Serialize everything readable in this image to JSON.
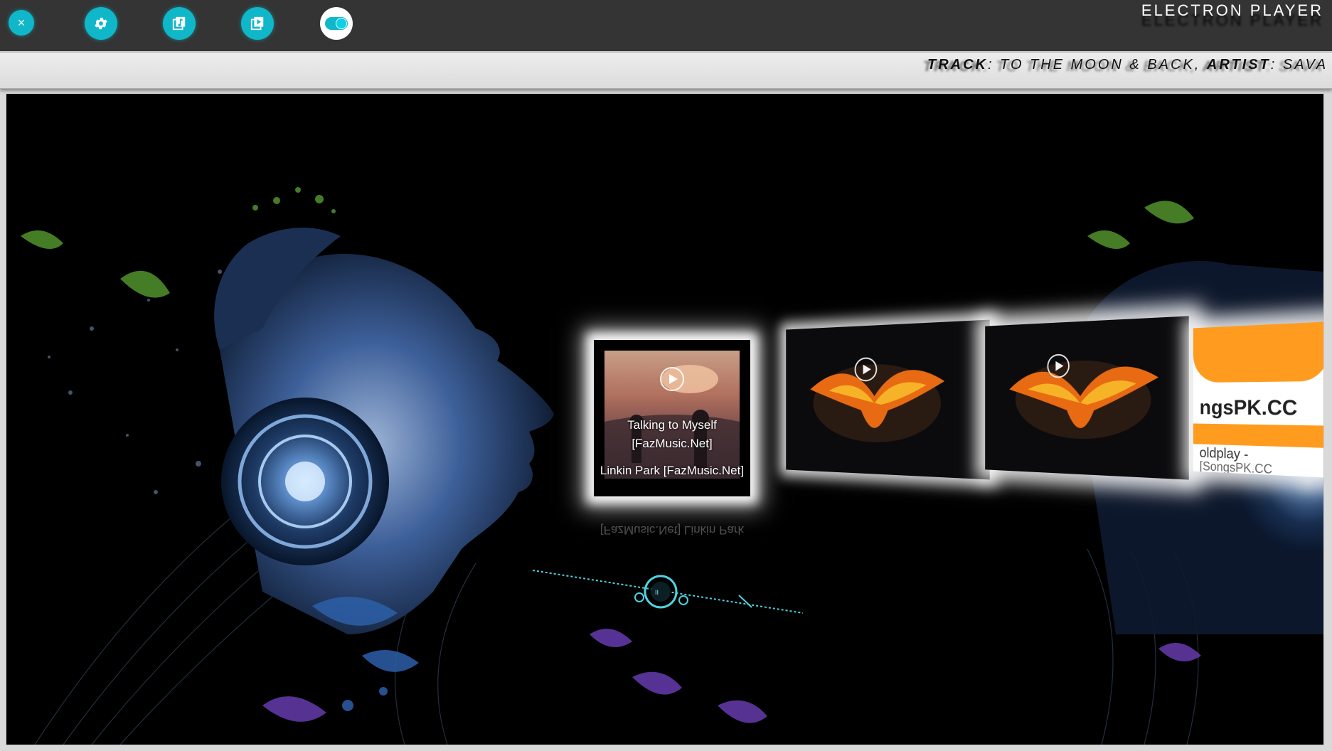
{
  "app": {
    "title": "ELECTRON PLAYER"
  },
  "toolbar": {
    "buttons": [
      {
        "name": "close-button",
        "icon": "close-icon"
      },
      {
        "name": "settings-button",
        "icon": "gear-icon"
      },
      {
        "name": "music-library-button",
        "icon": "music-library-icon"
      },
      {
        "name": "video-library-button",
        "icon": "video-library-icon"
      },
      {
        "name": "mode-toggle",
        "icon": "toggle-icon"
      }
    ]
  },
  "now_playing": {
    "track_label": "TRACK",
    "track": "TO THE MOON & BACK",
    "artist_label": "ARTIST",
    "artist": "SAVA"
  },
  "coverflow": {
    "front": {
      "title": "Talking to Myself [FazMusic.Net]",
      "artist": "Linkin Park [FazMusic.Net]",
      "reflection": "[FazMusic.Net] Linkin Park"
    },
    "side_partial_text_1": "ngsPK.CC",
    "side_partial_text_2": "oldplay -",
    "side_partial_text_3": "[SongsPK.CC"
  },
  "colors": {
    "accent": "#0fb7c9",
    "topbar": "#343434",
    "ticker_bg": "#e6e6e6"
  }
}
